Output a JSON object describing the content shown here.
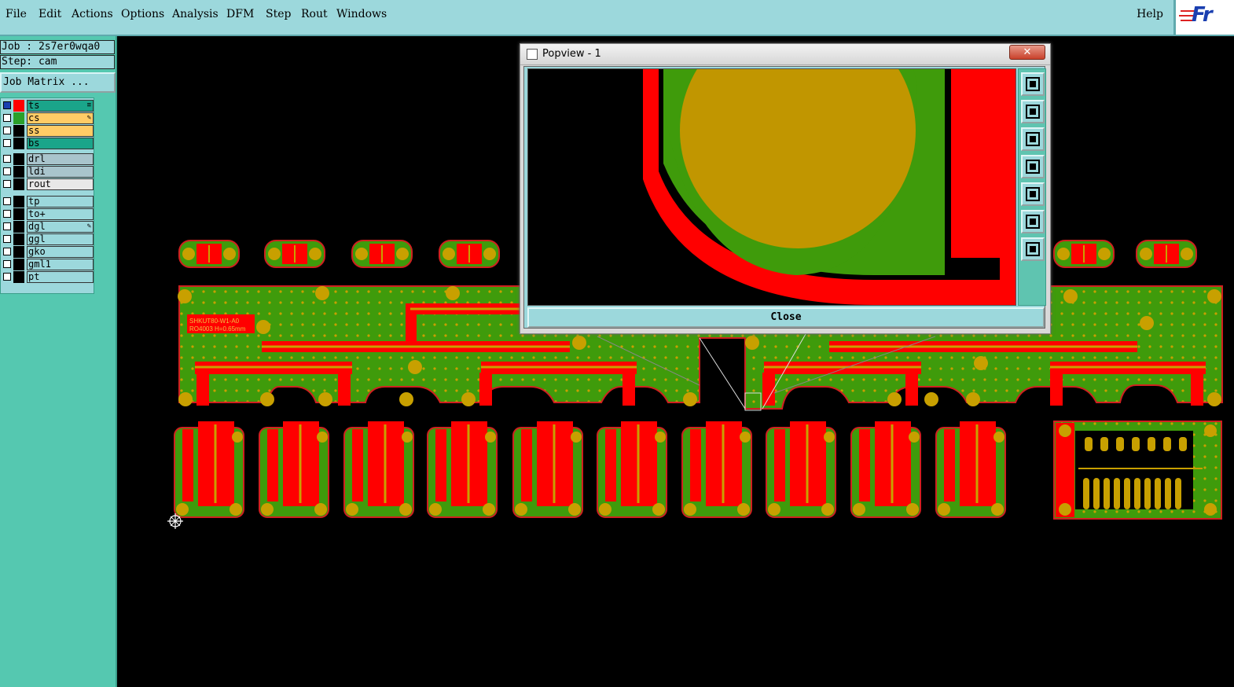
{
  "menu": {
    "file": "File",
    "edit": "Edit",
    "actions": "Actions",
    "options": "Options",
    "analysis": "Analysis",
    "dfm": "DFM",
    "step": "Step",
    "rout": "Rout",
    "windows": "Windows",
    "help": "Help"
  },
  "logo": {
    "text": "Fr"
  },
  "job": {
    "job_label": "Job : 2s7er0wqa0",
    "step_label": "Step: cam",
    "matrix_button": "Job Matrix ..."
  },
  "layers": [
    {
      "name": "ts",
      "color": "#1aa58a",
      "swatch": "#ff0000",
      "mark": "≡"
    },
    {
      "name": "cs",
      "color": "#ffcc66",
      "swatch": "#2aa02a",
      "mark": "✎"
    },
    {
      "name": "ss",
      "color": "#ffcc66",
      "swatch": "#000000",
      "mark": ""
    },
    {
      "name": "bs",
      "color": "#1aa58a",
      "swatch": "#000000",
      "mark": ""
    },
    {
      "name": "drl",
      "color": "#a9c4cc",
      "swatch": "#000000",
      "mark": ""
    },
    {
      "name": "ldi",
      "color": "#a9c4cc",
      "swatch": "#000000",
      "mark": ""
    },
    {
      "name": "rout",
      "color": "#e8e8e8",
      "swatch": "#000000",
      "mark": ""
    },
    {
      "name": "tp",
      "color": "#9cd8dc",
      "swatch": "#000000",
      "mark": ""
    },
    {
      "name": "to+",
      "color": "#9cd8dc",
      "swatch": "#000000",
      "mark": ""
    },
    {
      "name": "dgl",
      "color": "#9cd8dc",
      "swatch": "#000000",
      "mark": "✎"
    },
    {
      "name": "ggl",
      "color": "#9cd8dc",
      "swatch": "#000000",
      "mark": ""
    },
    {
      "name": "gko",
      "color": "#9cd8dc",
      "swatch": "#000000",
      "mark": ""
    },
    {
      "name": "gml1",
      "color": "#9cd8dc",
      "swatch": "#000000",
      "mark": ""
    },
    {
      "name": "pt",
      "color": "#9cd8dc",
      "swatch": "#000000",
      "mark": ""
    }
  ],
  "popview": {
    "title": "Popview - 1",
    "close_label": "Close",
    "close_x": "✕",
    "tools": [
      "zoom-window-icon",
      "pan-up-icon",
      "pan-down-icon",
      "pan-left-icon",
      "pan-right-icon",
      "zoom-fit-icon",
      "zoom-center-icon"
    ]
  },
  "board": {
    "large_label": "SHKUT80-W1-A0",
    "large_label_2": "RO4003  H=0.65mm",
    "colors": {
      "green": "#3f9b0b",
      "red": "#ff0000",
      "gold": "#c8a000",
      "outline": "#d02020"
    }
  }
}
